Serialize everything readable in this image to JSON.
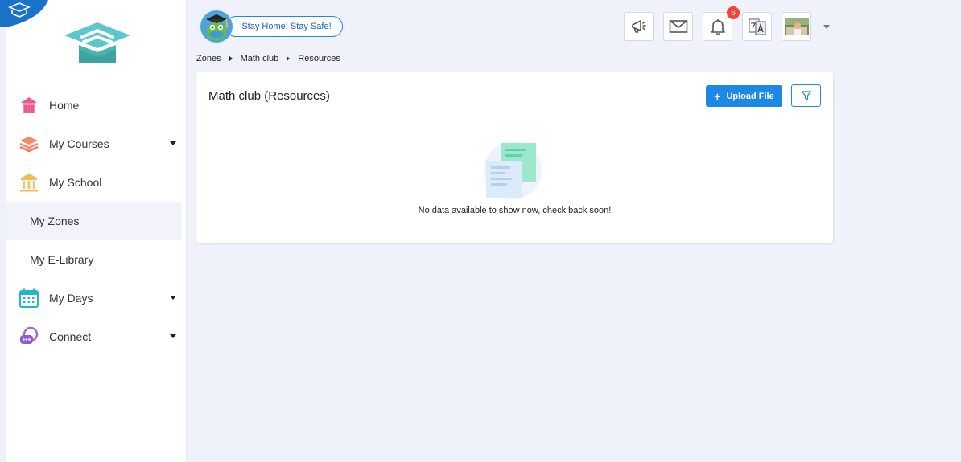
{
  "header": {
    "campaign_label": "Stay Home! Stay Safe!",
    "notification_count": "6"
  },
  "icons": {
    "announcements": "megaphone-icon",
    "messages": "envelope-icon",
    "notifications": "bell-icon",
    "language": "translate-icon",
    "avatar": "avatar"
  },
  "sidebar": {
    "items": [
      {
        "label": "Home",
        "icon": "home-icon"
      },
      {
        "label": "My Courses",
        "icon": "courses-icon"
      },
      {
        "label": "My School",
        "icon": "school-icon"
      },
      {
        "label": "My Zones"
      },
      {
        "label": "My E-Library"
      },
      {
        "label": "My Days",
        "icon": "calendar-icon"
      },
      {
        "label": "Connect",
        "icon": "chat-icon"
      }
    ]
  },
  "breadcrumb": [
    "Zones",
    "Math club",
    "Resources"
  ],
  "card": {
    "title": "Math club (Resources)",
    "upload_label": "Upload File",
    "empty_message": "No data available to show now, check back soon!"
  },
  "colors": {
    "accent": "#1e88e5",
    "badge": "#f44336",
    "background": "#eff1fb"
  }
}
